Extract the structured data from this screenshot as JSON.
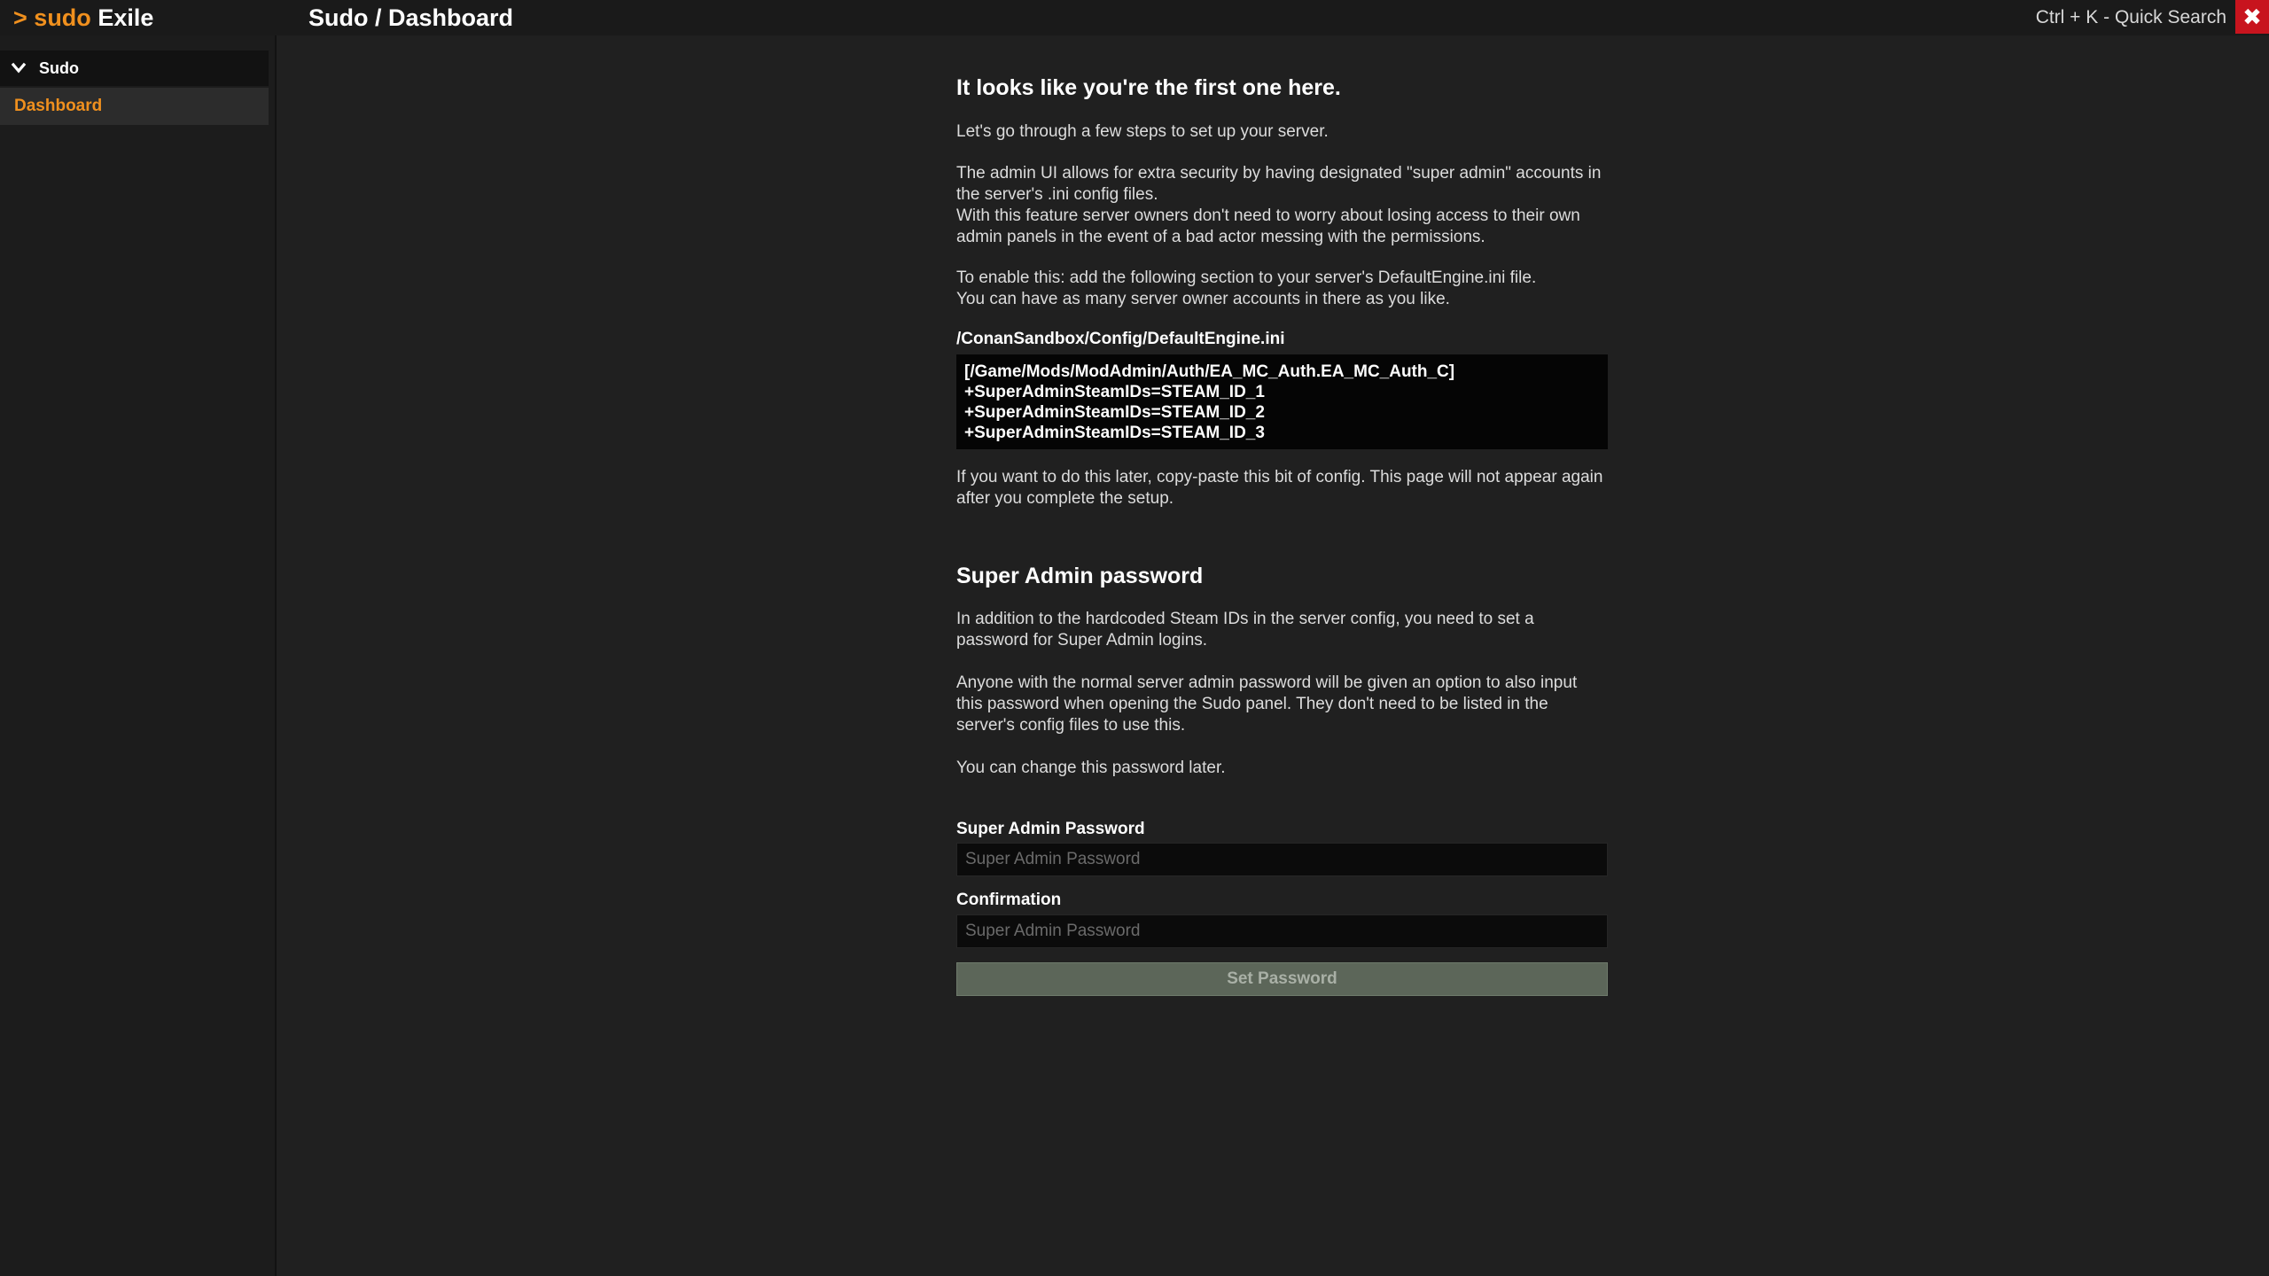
{
  "app": {
    "brand_prompt": ">",
    "brand_sudo": "sudo",
    "brand_name": "Exile",
    "breadcrumb": "Sudo / Dashboard",
    "quick_search": "Ctrl + K - Quick Search",
    "close_glyph": "✖",
    "accent_color": "#f0901e",
    "close_color": "#c8141e"
  },
  "sidebar": {
    "group_label": "Sudo",
    "group_icon": "chevron-down-icon",
    "items": [
      {
        "label": "Dashboard",
        "active": true
      }
    ]
  },
  "setup": {
    "heading": "It looks like you're the first one here.",
    "intro": "Let's go through a few steps to set up your server.",
    "security_p1": "The admin UI allows for extra security by having designated \"super admin\" accounts in the server's .ini config files.",
    "security_p2": "With this feature server owners don't need to worry about losing access to their own admin panels in the event of a bad actor messing with the permissions.",
    "enable_p1": "To enable this: add the following section to your server's DefaultEngine.ini file.",
    "enable_p2": "You can have as many server owner accounts in there as you like.",
    "file_path": "/ConanSandbox/Config/DefaultEngine.ini",
    "config_lines": [
      "[/Game/Mods/ModAdmin/Auth/EA_MC_Auth.EA_MC_Auth_C]",
      "+SuperAdminSteamIDs=STEAM_ID_1",
      "+SuperAdminSteamIDs=STEAM_ID_2",
      "+SuperAdminSteamIDs=STEAM_ID_3"
    ],
    "later_note": "If you want to do this later, copy-paste this bit of config. This page will not appear again after you complete the setup."
  },
  "password": {
    "heading": "Super Admin password",
    "p1": "In addition to the hardcoded Steam IDs in the server config, you need to set a password for Super Admin logins.",
    "p2": "Anyone with the normal server admin password will be given an option to also input this password when opening the Sudo panel. They don't need to be listed in the server's config files to use this.",
    "p3": "You can change this password later.",
    "field_label": "Super Admin Password",
    "field_placeholder": "Super Admin Password",
    "field_value": "",
    "confirm_label": "Confirmation",
    "confirm_placeholder": "Super Admin Password",
    "confirm_value": "",
    "submit_label": "Set Password"
  }
}
